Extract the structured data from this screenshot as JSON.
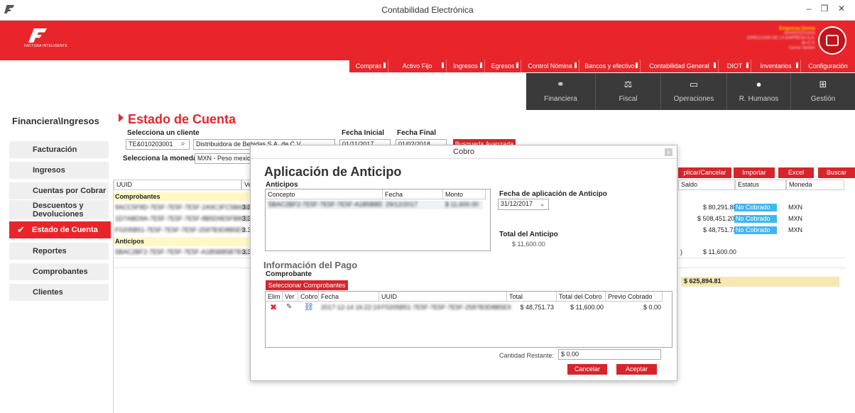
{
  "window": {
    "title": "Contabilidad Electrónica",
    "minimize": "–",
    "restore": "❐",
    "close": "✕"
  },
  "header": {
    "logo_text": "FACTURA INTELIGENTE",
    "company_name": "Empresa Demo",
    "company_lines": [
      "AAA010101AAA",
      "DIRECCION DE LA EMPRESA S.A. de C.V.",
      "Cerrar Sesión"
    ],
    "avatar_icon": "monitor-icon"
  },
  "menu": [
    {
      "label": "Compras"
    },
    {
      "label": "Activo Fijo"
    },
    {
      "label": "Ingresos"
    },
    {
      "label": "Egresos"
    },
    {
      "label": "Control Nómina"
    },
    {
      "label": "Bancos y efectivo"
    },
    {
      "label": "Contabilidad General"
    },
    {
      "label": "DIOT"
    },
    {
      "label": "Inventarios"
    },
    {
      "label": "Configuración"
    }
  ],
  "modules": [
    {
      "label": "Financiera",
      "icon": "coins-icon"
    },
    {
      "label": "Fiscal",
      "icon": "scale-icon"
    },
    {
      "label": "Operaciones",
      "icon": "clipboard-icon"
    },
    {
      "label": "R. Humanos",
      "icon": "person-icon"
    },
    {
      "label": "Gestión",
      "icon": "hierarchy-icon"
    }
  ],
  "breadcrumb": "Financiera\\Ingresos",
  "sidebar": {
    "items": [
      {
        "label": "Facturación"
      },
      {
        "label": "Ingresos"
      },
      {
        "label": "Cuentas por Cobrar"
      },
      {
        "label": "Descuentos y Devoluciones"
      },
      {
        "label": "Estado de Cuenta",
        "active": true
      },
      {
        "label": "Reportes"
      },
      {
        "label": "Comprobantes"
      },
      {
        "label": "Clientes"
      }
    ]
  },
  "page": {
    "title": "Estado de Cuenta",
    "client_label": "Selecciona un cliente",
    "client_rfc": "TE&010203001",
    "client_name": "Distribuidora de Bebidas S.A. de C.V.",
    "currency_label": "Selecciona la moneda",
    "currency_value": "MXN - Peso mexicano",
    "fecha_inicial_label": "Fecha Inicial",
    "fecha_inicial": "01/11/2017",
    "fecha_final_label": "Fecha Final",
    "fecha_final": "01/02/2018",
    "busqueda_btn": "Busqueda Avanzada",
    "actions": {
      "aplicar": "plicar/Cancelar",
      "importar": "Importar",
      "excel": "Excel",
      "buscar": "Buscar"
    }
  },
  "grid": {
    "headers": {
      "uuid": "UUID",
      "ve": "Ve",
      "saldo": "Saldo",
      "estatus": "Estatus",
      "moneda": "Moneda"
    },
    "group_comprobantes": "Comprobantes",
    "group_anticipos": "Anticipos",
    "rows": [
      {
        "uuid": "9ACC5F8D-7E5F-7E5F-7E5F-2A9C3FC5B6D8",
        "ver": "3.3",
        "saldo": "$ 80,291.88",
        "estatus": "No Cobrado",
        "moneda": "MXN"
      },
      {
        "uuid": "1D7ABD9A-7E5F-7E5F-7E5F-8B5D9E5FB8C5",
        "ver": "3.3",
        "saldo": "$ 508,451.20",
        "estatus": "No Cobrado",
        "moneda": "MXN"
      },
      {
        "uuid": "F0205B51-7E5F-7E5F-7E5F-2587B3D8B5E9",
        "ver": "3.3",
        "saldo": "$ 48,751.73",
        "estatus": "No Cobrado",
        "moneda": "MXN"
      }
    ],
    "anticipo_row": {
      "uuid": "5BAC2BF2-7E5F-7E5F-7E5F-A1B5BB5B7B12",
      "ver": "3.3",
      "saldo": "$ 11,600.00",
      "prefix": ")"
    },
    "total": "$ 625,894.81"
  },
  "modal": {
    "window_title": "Cobro",
    "close": "x",
    "heading": "Aplicación de Anticipo",
    "anticipos_label": "Anticipos",
    "anticipos_headers": {
      "concepto": "Concepto",
      "fecha": "Fecha",
      "monto": "Monto"
    },
    "anticipo_row": {
      "concepto": "5BAC2BF2-7E5F-7E5F-7E5F-A1B5BB5B7B12",
      "fecha": "29/12/2017",
      "monto": "$ 11,600.00"
    },
    "fecha_aplicacion_label": "Fecha de aplicación de Anticipo",
    "fecha_aplicacion": "31/12/2017",
    "total_anticipo_label": "Total del Anticipo",
    "total_anticipo": "$ 11,600.00",
    "info_pago": "Información del Pago",
    "comprobante_label": "Comprobante",
    "seleccionar_btn": "Seleccionar Comprobantes",
    "pago_headers": {
      "elim": "Elim",
      "ver": "Ver",
      "cobro": "Cobro",
      "fecha": "Fecha",
      "uuid": "UUID",
      "total": "Total",
      "total_cobro": "Total del Cobro",
      "previo": "Previo Cobrado"
    },
    "pago_row": {
      "fecha": "2017-12-14 16:22:19",
      "uuid": "F0205B51-7E5F-7E5F-7E5F-2587B3D8B5E9",
      "total": "$ 48,751.73",
      "total_cobro": "$ 11,600.00",
      "previo": "$ 0.00"
    },
    "cantidad_label": "Cantidad Restante:",
    "cantidad_value": "$ 0.00",
    "cancelar": "Cancelar",
    "aceptar": "Aceptar"
  }
}
